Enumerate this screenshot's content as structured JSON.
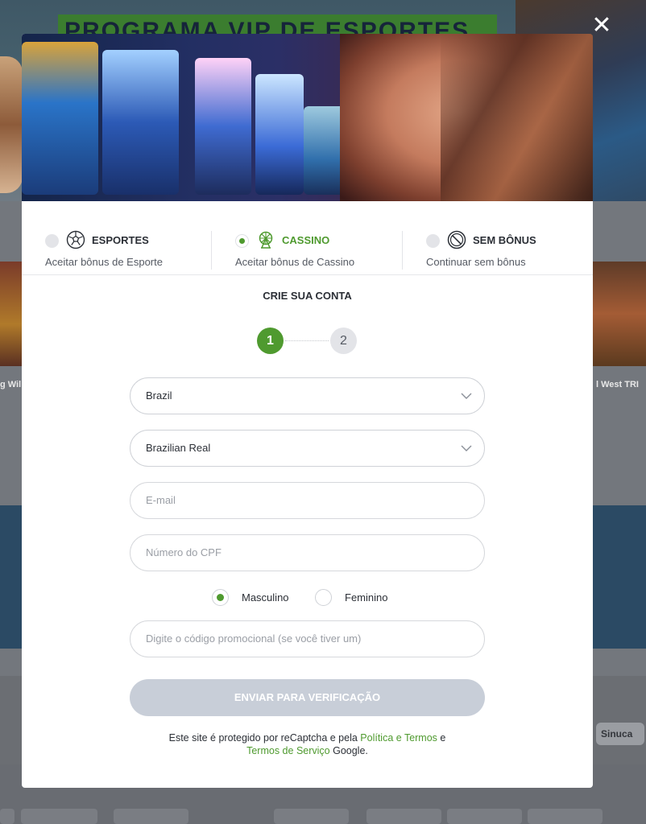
{
  "background": {
    "banner_text": "PROGRAMA VIP DE ESPORTES",
    "left_card_text": "g Wil",
    "right_card_text": "l West TRI",
    "pill_label": "Sinuca"
  },
  "close_label": "✕",
  "bonuses": [
    {
      "title": "ESPORTES",
      "subtitle": "Aceitar bônus de Esporte",
      "selected": false,
      "icon": "soccer-ball-icon"
    },
    {
      "title": "CASSINO",
      "subtitle": "Aceitar bônus de Cassino",
      "selected": true,
      "icon": "ferris-wheel-icon"
    },
    {
      "title": "SEM BÔNUS",
      "subtitle": "Continuar sem bônus",
      "selected": false,
      "icon": "no-symbol-icon"
    }
  ],
  "form": {
    "heading": "CRIE SUA CONTA",
    "steps": [
      "1",
      "2"
    ],
    "country": "Brazil",
    "currency": "Brazilian Real",
    "email_placeholder": "E-mail",
    "cpf_placeholder": "Número do CPF",
    "gender_options": [
      "Masculino",
      "Feminino"
    ],
    "gender_selected": "Masculino",
    "promo_placeholder": "Digite o código promocional (se você tiver um)",
    "submit_label": "ENVIAR PARA VERIFICAÇÃO"
  },
  "legal": {
    "prefix": "Este site é protegido por reCaptcha e pela ",
    "link1": "Política e Termos",
    "middle": " e",
    "link2": "Termos de Serviço",
    "suffix": " Google."
  },
  "colors": {
    "accent": "#4f9a2f",
    "button_disabled": "#c8ced8"
  }
}
